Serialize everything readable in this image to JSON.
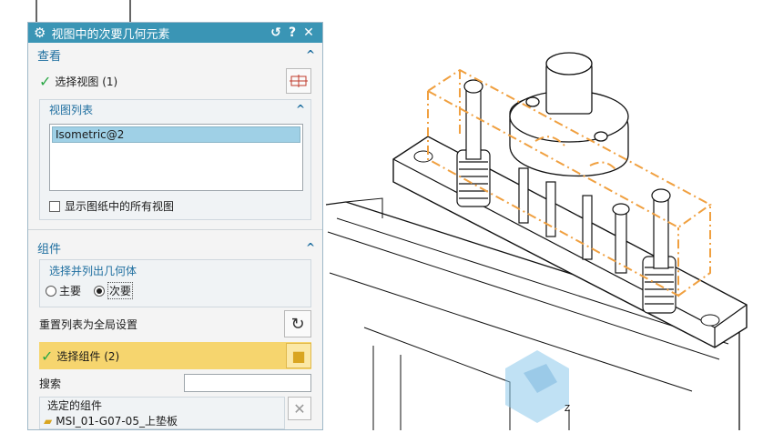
{
  "dialog": {
    "title": "视图中的次要几何元素",
    "icons": {
      "settings": "gear-icon",
      "reset": "reset-icon",
      "help": "help-icon",
      "close": "close-icon"
    }
  },
  "view_section": {
    "header": "查看",
    "select_view_label": "选择视图 (1)",
    "view_list_header": "视图列表",
    "view_list_items": [
      "Isometric@2"
    ],
    "show_all_label": "显示图纸中的所有视图"
  },
  "component_section": {
    "header": "组件",
    "list_geometry_header": "选择并列出几何体",
    "primary_label": "主要",
    "secondary_label": "次要",
    "secondary_selected": true,
    "reset_label": "重置列表为全局设置",
    "select_component_label": "选择组件 (2)",
    "search_label": "搜索",
    "search_value": "",
    "selected_header": "选定的组件",
    "selected_items": [
      "MSI_01-G07-05_上垫板"
    ]
  },
  "colors": {
    "titlebar": "#3a95b5",
    "highlight": "#f6d56e",
    "accent_orange": "#f0a040"
  }
}
